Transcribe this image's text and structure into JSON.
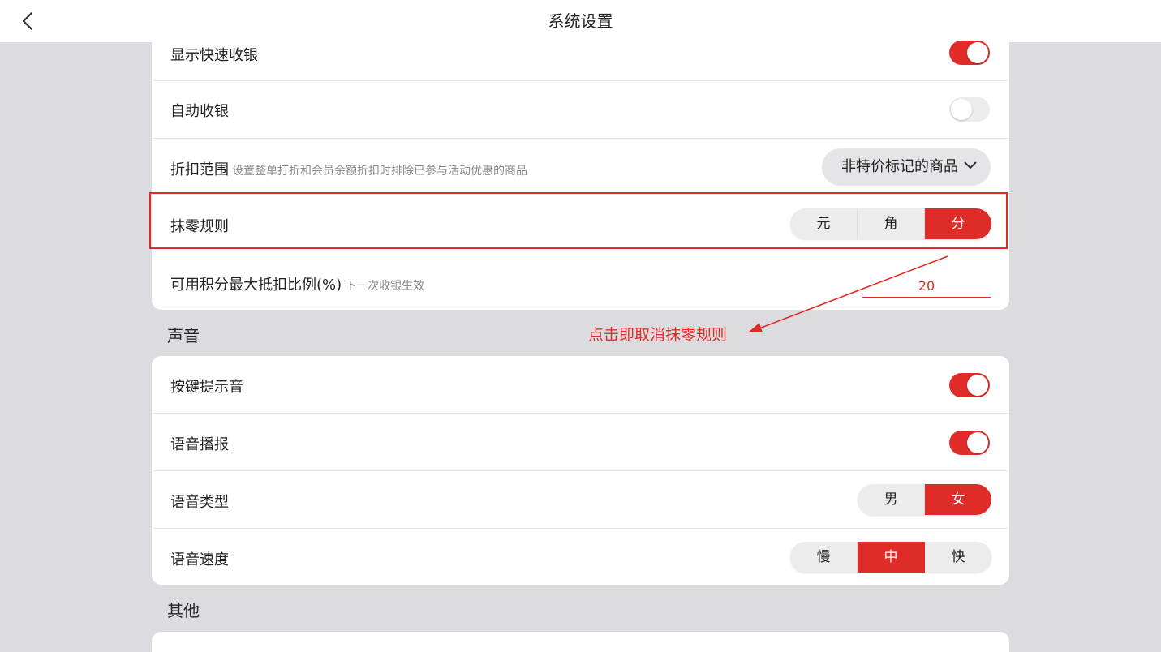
{
  "header": {
    "title": "系统设置",
    "back_icon": "chevron-left-icon"
  },
  "settings": {
    "quick_cashier": {
      "label": "显示快速收银",
      "on": true
    },
    "self_checkout": {
      "label": "自助收银",
      "on": false
    },
    "discount_scope": {
      "label": "折扣范围",
      "hint": "设置整单打折和会员余额折扣时排除已参与活动优惠的商品",
      "value": "非特价标记的商品"
    },
    "rounding_rule": {
      "label": "抹零规则",
      "options": [
        "元",
        "角",
        "分"
      ],
      "selected": "分"
    },
    "points_ratio": {
      "label": "可用积分最大抵扣比例(%)",
      "hint": "下一次收银生效",
      "value": "20"
    }
  },
  "sections": {
    "sound": "声音",
    "other": "其他"
  },
  "sound": {
    "key_tone": {
      "label": "按键提示音",
      "on": true
    },
    "voice_broadcast": {
      "label": "语音播报",
      "on": true
    },
    "voice_type": {
      "label": "语音类型",
      "options": [
        "男",
        "女"
      ],
      "selected": "女"
    },
    "voice_speed": {
      "label": "语音速度",
      "options": [
        "慢",
        "中",
        "快"
      ],
      "selected": "中"
    }
  },
  "annotation": {
    "text": "点击即取消抹零规则"
  },
  "colors": {
    "accent": "#e02c28",
    "background": "#dcdce0"
  }
}
